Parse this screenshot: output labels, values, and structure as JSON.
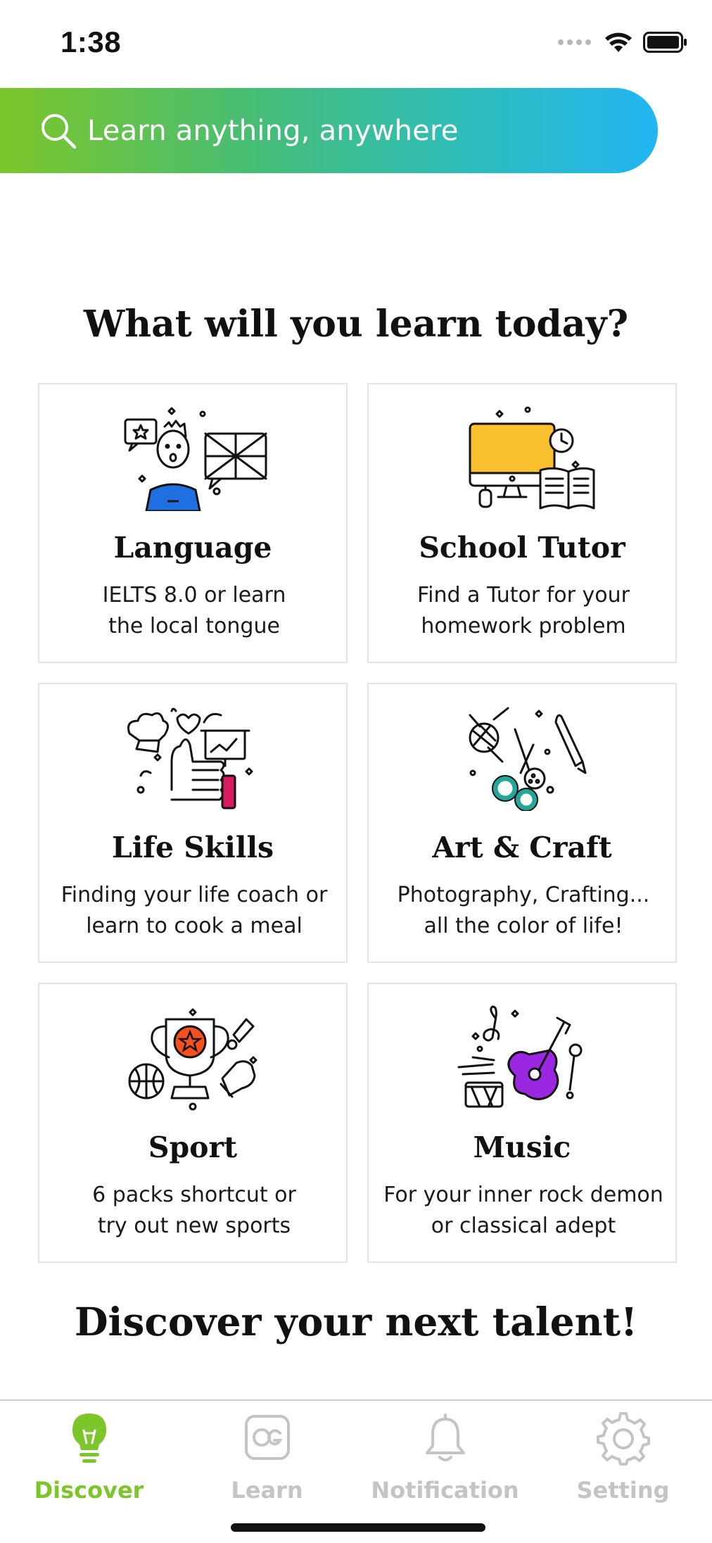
{
  "status_bar": {
    "time": "1:38"
  },
  "search": {
    "placeholder": "Learn anything, anywhere"
  },
  "title": "What will you learn today?",
  "categories": [
    {
      "title": "Language",
      "description": "IELTS 8.0 or learn\nthe local tongue",
      "icon": "language-icon",
      "accent": "#1f6fe0"
    },
    {
      "title": "School Tutor",
      "description": "Find a Tutor for your\nhomework problem",
      "icon": "school-tutor-icon",
      "accent": "#fbc02d"
    },
    {
      "title": "Life Skills",
      "description": "Finding your life coach or\nlearn to cook a meal",
      "icon": "life-skills-icon",
      "accent": "#d81b60"
    },
    {
      "title": "Art & Craft",
      "description": "Photography, Crafting...\nall the color of life!",
      "icon": "art-craft-icon",
      "accent": "#26a69a"
    },
    {
      "title": "Sport",
      "description": "6 packs shortcut or\ntry out new sports",
      "icon": "sport-icon",
      "accent": "#f4511e"
    },
    {
      "title": "Music",
      "description": "For your inner rock demon\nor classical adept",
      "icon": "music-icon",
      "accent": "#9c27e0"
    }
  ],
  "footer_title": "Discover your next talent!",
  "tabs": [
    {
      "label": "Discover",
      "icon": "lightbulb-icon",
      "active": true
    },
    {
      "label": "Learn",
      "icon": "og-logo-icon",
      "active": false
    },
    {
      "label": "Notification",
      "icon": "bell-icon",
      "active": false
    },
    {
      "label": "Setting",
      "icon": "gear-icon",
      "active": false
    }
  ],
  "colors": {
    "active_tab": "#7cc62a",
    "inactive_tab": "#c4c4c4",
    "gradient_start": "#7cc62a",
    "gradient_end": "#22b5f2"
  }
}
